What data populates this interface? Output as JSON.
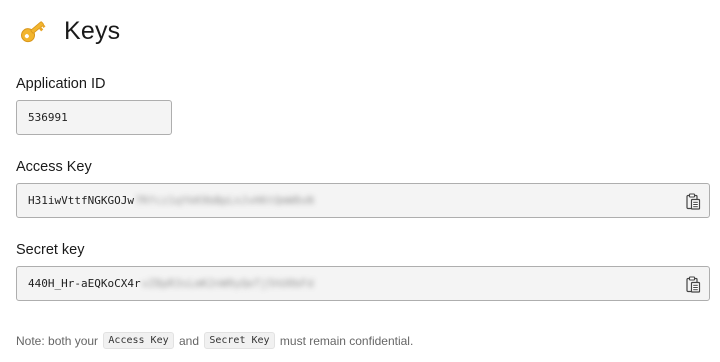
{
  "page": {
    "title": "Keys",
    "icon": "key-icon"
  },
  "application_id": {
    "label": "Application ID",
    "value": "536991"
  },
  "access_key": {
    "label": "Access Key",
    "visible_value": "H31iwVttfNGKGOJw",
    "masked_value": "7Rfcz1qYkK9bBpLnJvH6tQmW8xN",
    "copy_icon": "clipboard-copy-icon"
  },
  "secret_key": {
    "label": "Secret key",
    "visible_value": "440H_Hr-aEQKoCX4r",
    "masked_value": "vZ8pR3sLmK2nW9yQeTj5hU0bFd",
    "copy_icon": "clipboard-copy-icon"
  },
  "note": {
    "prefix": "Note: both your",
    "access_key_chip": "Access Key",
    "conjunction": "and",
    "secret_key_chip": "Secret Key",
    "suffix": "must remain confidential."
  }
}
